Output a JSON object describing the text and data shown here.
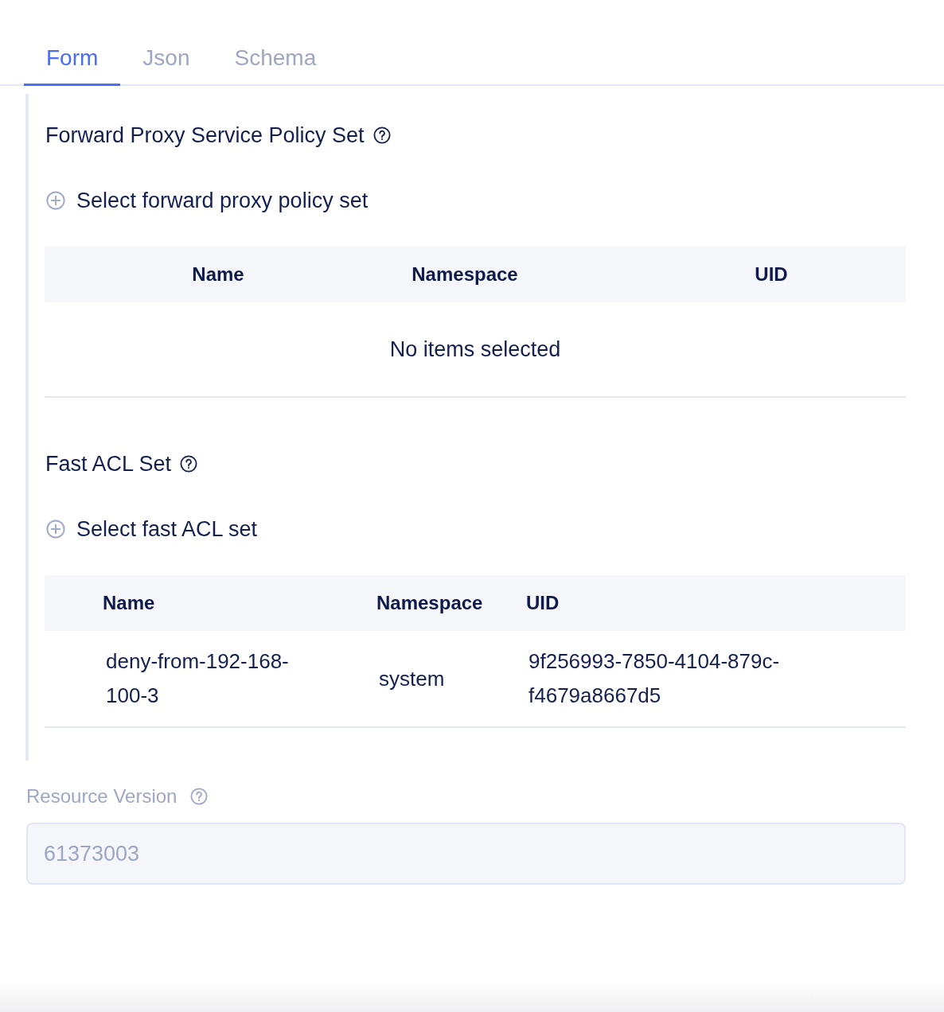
{
  "tabs": [
    {
      "label": "Form",
      "selected": true
    },
    {
      "label": "Json",
      "selected": false
    },
    {
      "label": "Schema",
      "selected": false
    }
  ],
  "sections": [
    {
      "title": "Forward Proxy Service Policy Set",
      "add_label": "Select forward proxy policy set",
      "table": {
        "columns": [
          "Name",
          "Namespace",
          "UID"
        ],
        "empty_text": "No items selected"
      }
    },
    {
      "title": "Fast ACL Set",
      "add_label": "Select fast ACL set",
      "table": {
        "columns": [
          "Name",
          "Namespace",
          "UID"
        ],
        "rows": [
          [
            "deny-from-192-168-100-3",
            "system",
            "9f256993-7850-4104-879c-f4679a8667d5"
          ]
        ]
      }
    }
  ],
  "resource_version": {
    "label": "Resource Version",
    "value": "61373003",
    "disabled": true
  }
}
